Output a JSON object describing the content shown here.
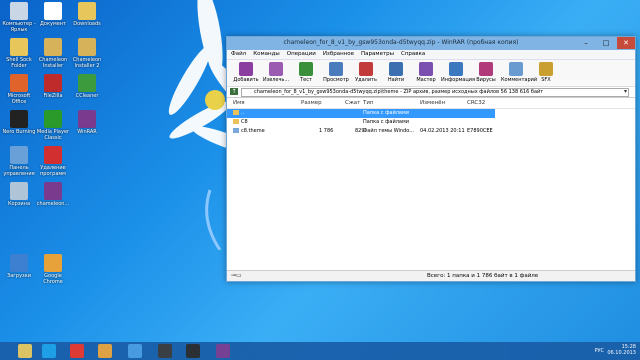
{
  "desktop": {
    "icons": [
      {
        "label": "Компьютер - Ярлык",
        "icon": "computer-icon",
        "color": "#c9d6e6"
      },
      {
        "label": "Документ",
        "icon": "document-icon",
        "color": "#ffffff"
      },
      {
        "label": "Downloads",
        "icon": "folder-icon",
        "color": "#e7c65c"
      },
      {
        "label": "Shell Sock Folder",
        "icon": "folder-icon",
        "color": "#e7c65c"
      },
      {
        "label": "Chameleon Installer",
        "icon": "folder-icon",
        "color": "#d6b25a"
      },
      {
        "label": "Chameleon Installer 2",
        "icon": "folder-icon",
        "color": "#d6b25a"
      },
      {
        "label": "Microsoft Office",
        "icon": "office-icon",
        "color": "#e0632b"
      },
      {
        "label": "FileZilla",
        "icon": "filezilla-icon",
        "color": "#bf2a2a"
      },
      {
        "label": "CCleaner",
        "icon": "ccleaner-icon",
        "color": "#3c9b3c"
      },
      {
        "label": "Nero Burning",
        "icon": "nero-icon",
        "color": "#222222"
      },
      {
        "label": "Media Player Classic",
        "icon": "play-icon",
        "color": "#2a9a2a"
      },
      {
        "label": "WinRAR",
        "icon": "winrar-icon",
        "color": "#7a3b8f"
      },
      {
        "label": "Панель управления",
        "icon": "control-panel-icon",
        "color": "#6aa0d8"
      },
      {
        "label": "Удаление программ",
        "icon": "uninstall-icon",
        "color": "#d23030"
      },
      {
        "label": "Корзина",
        "icon": "recycle-bin-icon",
        "color": "#b0c4d8"
      },
      {
        "label": "chameleon...",
        "icon": "winrar-icon",
        "color": "#7a3b8f"
      },
      {
        "label": "Загрузки",
        "icon": "download-icon",
        "color": "#3d7fd1"
      },
      {
        "label": "Google Chrome",
        "icon": "chrome-icon",
        "color": "#e8a23a"
      }
    ]
  },
  "window": {
    "title": "chameleon_for_8_v1_by_gsw953onda-d5twyqq.zip - WinRAR (пробная копия)",
    "menu": [
      "Файл",
      "Команды",
      "Операции",
      "Избранное",
      "Параметры",
      "Справка"
    ],
    "toolbar": [
      {
        "label": "Добавить",
        "icon": "add-icon",
        "color": "#8a3fa0"
      },
      {
        "label": "Извлечь...",
        "icon": "extract-icon",
        "color": "#9b5bb0"
      },
      {
        "label": "Тест",
        "icon": "test-icon",
        "color": "#3a8f3a"
      },
      {
        "label": "Просмотр",
        "icon": "view-icon",
        "color": "#4a7bbd"
      },
      {
        "label": "Удалить",
        "icon": "delete-icon",
        "color": "#c23a3a"
      },
      {
        "label": "Найти",
        "icon": "find-icon",
        "color": "#3b6fb0"
      },
      {
        "label": "Мастер",
        "icon": "wizard-icon",
        "color": "#7a4fb0"
      },
      {
        "label": "Информация",
        "icon": "info-icon",
        "color": "#3a78c0"
      },
      {
        "label": "Вирусы",
        "icon": "virus-scan-icon",
        "color": "#b03a7a"
      },
      {
        "label": "Комментарий",
        "icon": "comment-icon",
        "color": "#6a9bd0"
      },
      {
        "label": "SFX",
        "icon": "sfx-icon",
        "color": "#c9a030"
      }
    ],
    "path": "chameleon_for_8_v1_by_gsw953onda-d5twyqq.zip\\theme - ZIP архив, размер исходных файлов 56 138 616 байт",
    "columns": [
      "Имя",
      "Размер",
      "Сжат",
      "Тип",
      "Изменён",
      "CRC32"
    ],
    "rows": [
      {
        "name": "..",
        "size": "",
        "packed": "",
        "type": "Папка с файлами",
        "modified": "",
        "crc": "",
        "selected": true
      },
      {
        "name": "C8",
        "size": "",
        "packed": "",
        "type": "Папка с файлами",
        "modified": "",
        "crc": "",
        "selected": false
      },
      {
        "name": "c8.theme",
        "size": "1 786",
        "packed": "829",
        "type": "Файл темы Windo...",
        "modified": "04.02.2013 20:11",
        "crc": "E7890CEE",
        "selected": false
      }
    ],
    "status": "Всего: 1 папка и 1 786 байт в 1 файле"
  },
  "taskbar": {
    "items": [
      {
        "icon": "file-explorer-icon",
        "color": "#e7c65c"
      },
      {
        "icon": "skype-icon",
        "color": "#1da1e6"
      },
      {
        "icon": "yandex-icon",
        "color": "#e8362c"
      },
      {
        "icon": "chrome-icon",
        "color": "#e8a23a"
      },
      {
        "icon": "windows-icon",
        "color": "#4a9be0"
      },
      {
        "icon": "video-recorder-icon",
        "color": "#3a3a3a"
      },
      {
        "icon": "terminal-icon",
        "color": "#2a2a2a"
      },
      {
        "icon": "winrar-icon",
        "color": "#7a3b8f"
      }
    ],
    "lang": "РУС",
    "time": "15:28",
    "date": "06.10.2013"
  }
}
